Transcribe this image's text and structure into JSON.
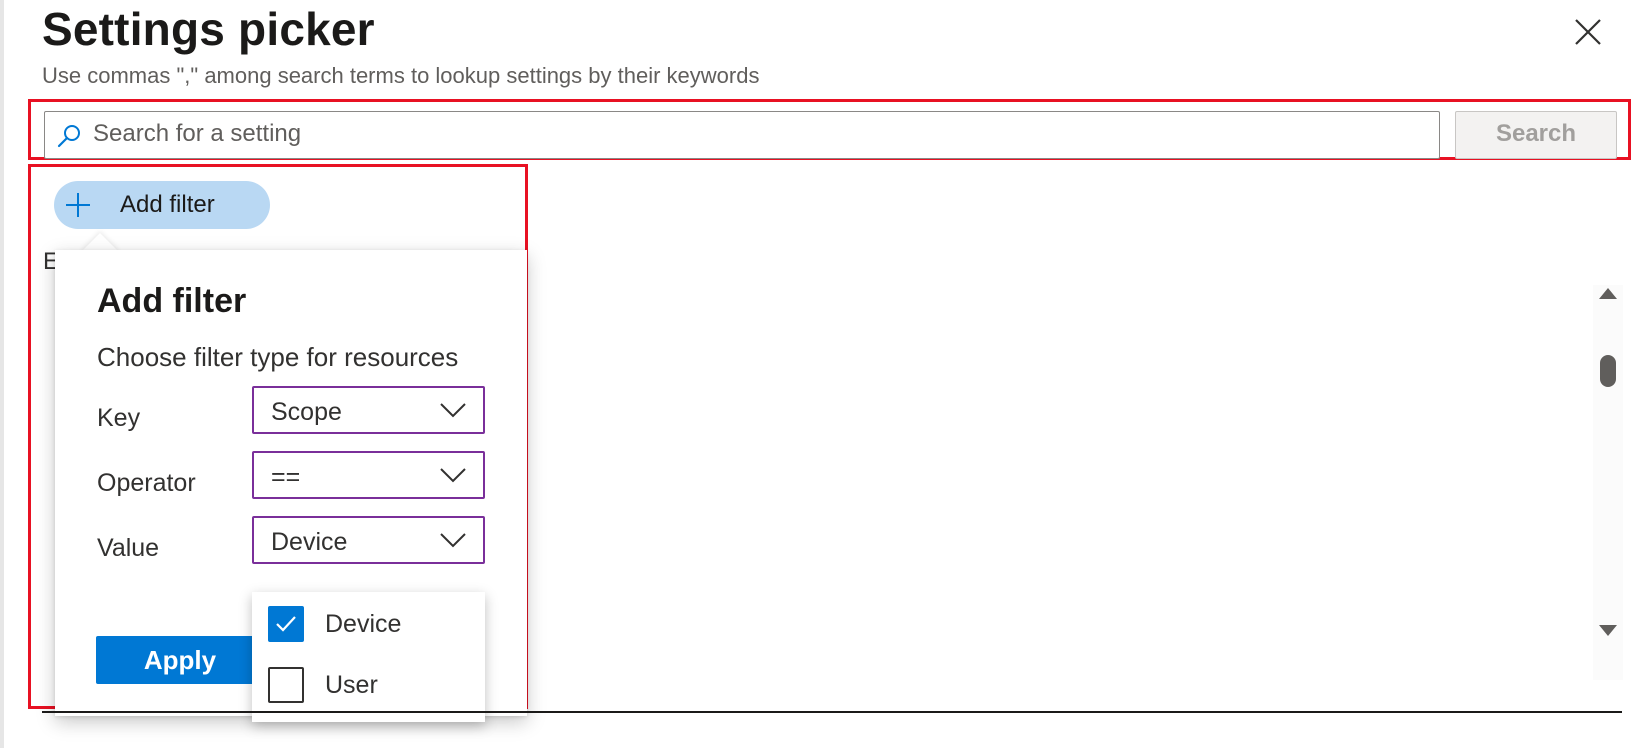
{
  "header": {
    "title": "Settings picker",
    "subtitle": "Use commas \",\" among search terms to lookup settings by their keywords"
  },
  "search": {
    "placeholder": "Search for a setting",
    "value": "",
    "button_label": "Search"
  },
  "toolbar": {
    "add_filter_label": "Add filter"
  },
  "background": {
    "partial_letter": "E"
  },
  "filter_callout": {
    "title": "Add filter",
    "description": "Choose filter type for resources",
    "fields": [
      {
        "label": "Key",
        "value": "Scope"
      },
      {
        "label": "Operator",
        "value": "=="
      },
      {
        "label": "Value",
        "value": "Device"
      }
    ],
    "apply_label": "Apply",
    "value_options": [
      {
        "label": "Device",
        "checked": true
      },
      {
        "label": "User",
        "checked": false
      }
    ]
  },
  "colors": {
    "accent": "#0078d4",
    "highlight_border": "#e81123",
    "dropdown_border": "#7a2f9a",
    "pill_background": "#b9d8f3"
  },
  "icons": {
    "close": "close-icon",
    "search": "search-icon",
    "add": "plus-icon",
    "dropdown": "chevron-down-icon",
    "check": "checkmark-icon",
    "scroll_up": "scroll-up-arrow-icon",
    "scroll_down": "scroll-down-arrow-icon"
  }
}
